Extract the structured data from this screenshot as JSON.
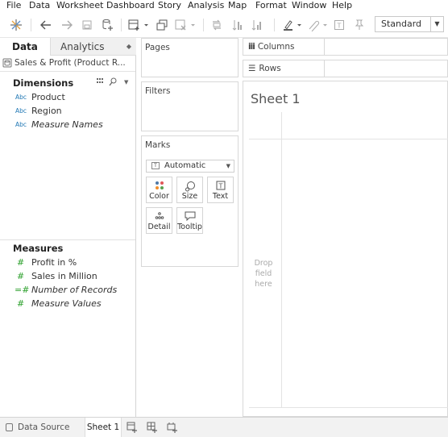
{
  "menu": [
    "File",
    "Data",
    "Worksheet",
    "Dashboard",
    "Story",
    "Analysis",
    "Map",
    "Format",
    "Window",
    "Help"
  ],
  "toolbar": {
    "fit_select": "Standard",
    "icons": [
      "tableau-logo-icon",
      "undo-icon",
      "redo-icon",
      "save-icon",
      "new-data-source-icon",
      "new-worksheet-icon",
      "duplicate-icon",
      "clear-icon",
      "swap-icon",
      "sort-ascending-icon",
      "sort-descending-icon",
      "highlight-icon",
      "group-icon",
      "label-icon",
      "pin-icon"
    ]
  },
  "data_pane": {
    "tab_data": "Data",
    "tab_analytics": "Analytics",
    "data_source": "Sales & Profit (Product R...",
    "dimensions_title": "Dimensions",
    "dimensions": [
      {
        "type": "Abc",
        "name": "Product"
      },
      {
        "type": "Abc",
        "name": "Region"
      },
      {
        "type": "Abc",
        "name": "Measure Names"
      }
    ],
    "measures_title": "Measures",
    "measures": [
      {
        "type": "#",
        "name": "Profit in %"
      },
      {
        "type": "#",
        "name": "Sales in Million"
      },
      {
        "type": "=#",
        "name": "Number of Records"
      },
      {
        "type": "#",
        "name": "Measure Values"
      }
    ]
  },
  "cards": {
    "pages": "Pages",
    "filters": "Filters",
    "marks": "Marks",
    "mark_type": "Automatic",
    "mark_buttons": [
      "Color",
      "Size",
      "Text",
      "Detail",
      "Tooltip"
    ]
  },
  "shelves": {
    "columns": "Columns",
    "rows": "Rows"
  },
  "view": {
    "sheet_title": "Sheet 1",
    "drop_hint": "Drop field here"
  },
  "bottom": {
    "data_source": "Data Source",
    "sheet_tab": "Sheet 1"
  }
}
